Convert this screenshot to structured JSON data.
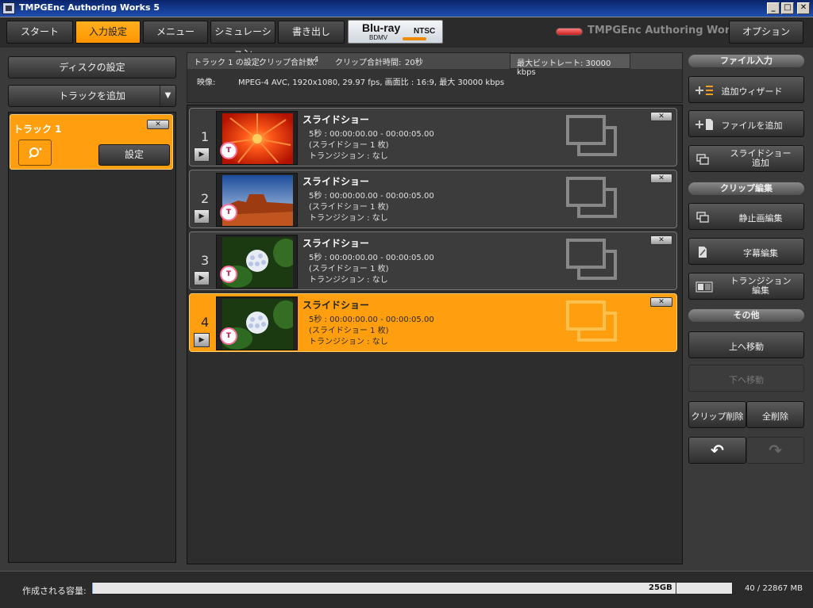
{
  "window": {
    "title": "TMPGEnc Authoring Works 5",
    "minimize": "_",
    "maximize": "□",
    "close": "✕"
  },
  "nav": {
    "tabs": [
      "スタート",
      "入力設定",
      "メニュー",
      "シミュレーション",
      "書き出し"
    ],
    "active_index": 1,
    "format_badge": {
      "line1": "Blu-ray",
      "line2": "BDMV",
      "standard": "NTSC"
    },
    "brand": "TMPGEnc Authoring Works 5",
    "options_label": "オプション"
  },
  "left": {
    "disc_settings_label": "ディスクの設定",
    "add_track_label": "トラックを追加",
    "dropdown_arrow": "▼",
    "track": {
      "name": "トラック 1",
      "close": "✕",
      "settings_label": "設定"
    }
  },
  "info": {
    "track_settings": "トラック 1 の設定:",
    "clip_count_label": "クリップ合計数:",
    "clip_count": "4",
    "clip_time_label": "クリップ合計時間:",
    "clip_time": "20秒",
    "max_bitrate": "最大ビットレート: 30000 kbps",
    "video_label": "映像:",
    "video_spec": "MPEG-4 AVC,  1920x1080,  29.97 fps,  画面比 : 16:9,  最大  30000 kbps"
  },
  "clips": [
    {
      "number": "1",
      "title": "スライドショー",
      "duration": "5秒 :  00:00:00.00 - 00:00:05.00",
      "count": "(スライドショー 1 枚)",
      "transition": "トランジション : なし",
      "selected": false,
      "thumb": "red-flower"
    },
    {
      "number": "2",
      "title": "スライドショー",
      "duration": "5秒 :  00:00:00.00 - 00:00:05.00",
      "count": "(スライドショー 1 枚)",
      "transition": "トランジション : なし",
      "selected": false,
      "thumb": "desert"
    },
    {
      "number": "3",
      "title": "スライドショー",
      "duration": "5秒 :  00:00:00.00 - 00:00:05.00",
      "count": "(スライドショー 1 枚)",
      "transition": "トランジション : なし",
      "selected": false,
      "thumb": "hydrangea"
    },
    {
      "number": "4",
      "title": "スライドショー",
      "duration": "5秒 :  00:00:00.00 - 00:00:05.00",
      "count": "(スライドショー 1 枚)",
      "transition": "トランジション : なし",
      "selected": true,
      "thumb": "hydrangea"
    }
  ],
  "clip_play": "▶",
  "clip_close": "✕",
  "clip_mark": "T",
  "right": {
    "file_input_header": "ファイル入力",
    "add_wizard": "追加ウィザード",
    "add_file": "ファイルを追加",
    "add_slideshow_1": "スライドショー",
    "add_slideshow_2": "追加",
    "clip_edit_header": "クリップ編集",
    "still_edit": "静止画編集",
    "subtitle_edit": "字幕編集",
    "transition_edit_1": "トランジション",
    "transition_edit_2": "編集",
    "other_header": "その他",
    "move_up": "上へ移動",
    "move_down": "下へ移動",
    "clip_delete": "クリップ削除",
    "delete_all": "全削除",
    "undo": "↶",
    "redo": "↷"
  },
  "bottom": {
    "capacity_label": "作成される容量:",
    "disc_size": "25GB",
    "usage": "40 / 22867 MB",
    "usage_fraction": 0.0017
  },
  "colors": {
    "accent": "#ff9f0f",
    "background": "#3a3a3a",
    "panel": "#2d2d2d"
  }
}
